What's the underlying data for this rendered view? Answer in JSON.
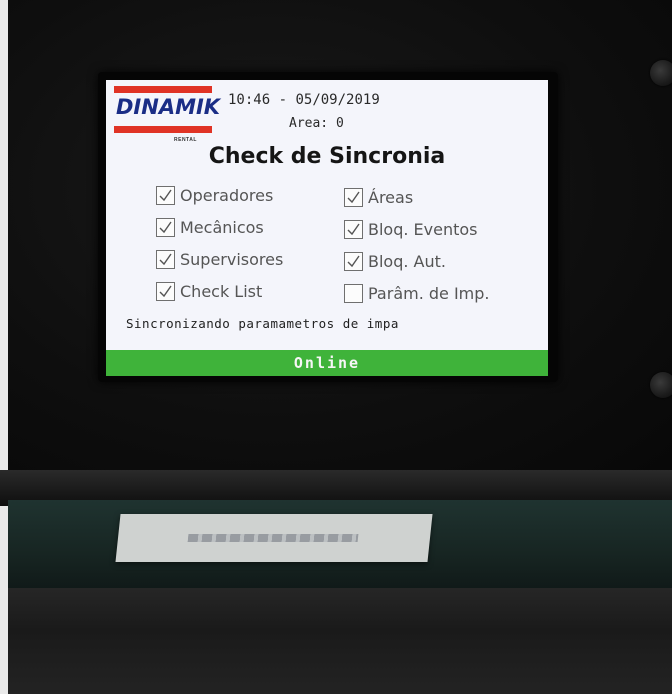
{
  "device": {
    "brand": "DINAMIK",
    "brand_sub": "RENTAL",
    "time": "10:46",
    "separator": "-",
    "date": "05/09/2019",
    "area": "Area: 0"
  },
  "screen": {
    "title": "Check de Sincronia",
    "checks": [
      {
        "label": "Operadores",
        "checked": true
      },
      {
        "label": "Áreas",
        "checked": true
      },
      {
        "label": "Mecânicos",
        "checked": true
      },
      {
        "label": "Bloq. Eventos",
        "checked": true
      },
      {
        "label": "Supervisores",
        "checked": true
      },
      {
        "label": "Bloq. Aut.",
        "checked": true
      },
      {
        "label": "Check List",
        "checked": true
      },
      {
        "label": "Parâm. de Imp.",
        "checked": false
      }
    ],
    "sync_message": "Sincronizando paramametros de impa",
    "status": "Online",
    "status_color": "#3fb33a"
  },
  "colors": {
    "brand_red": "#e03325",
    "brand_blue": "#1a2d86",
    "screen_bg": "#f4f5fb"
  },
  "icons": {
    "checkbox": "checkbox-icon",
    "checkmark": "checkmark-icon"
  }
}
